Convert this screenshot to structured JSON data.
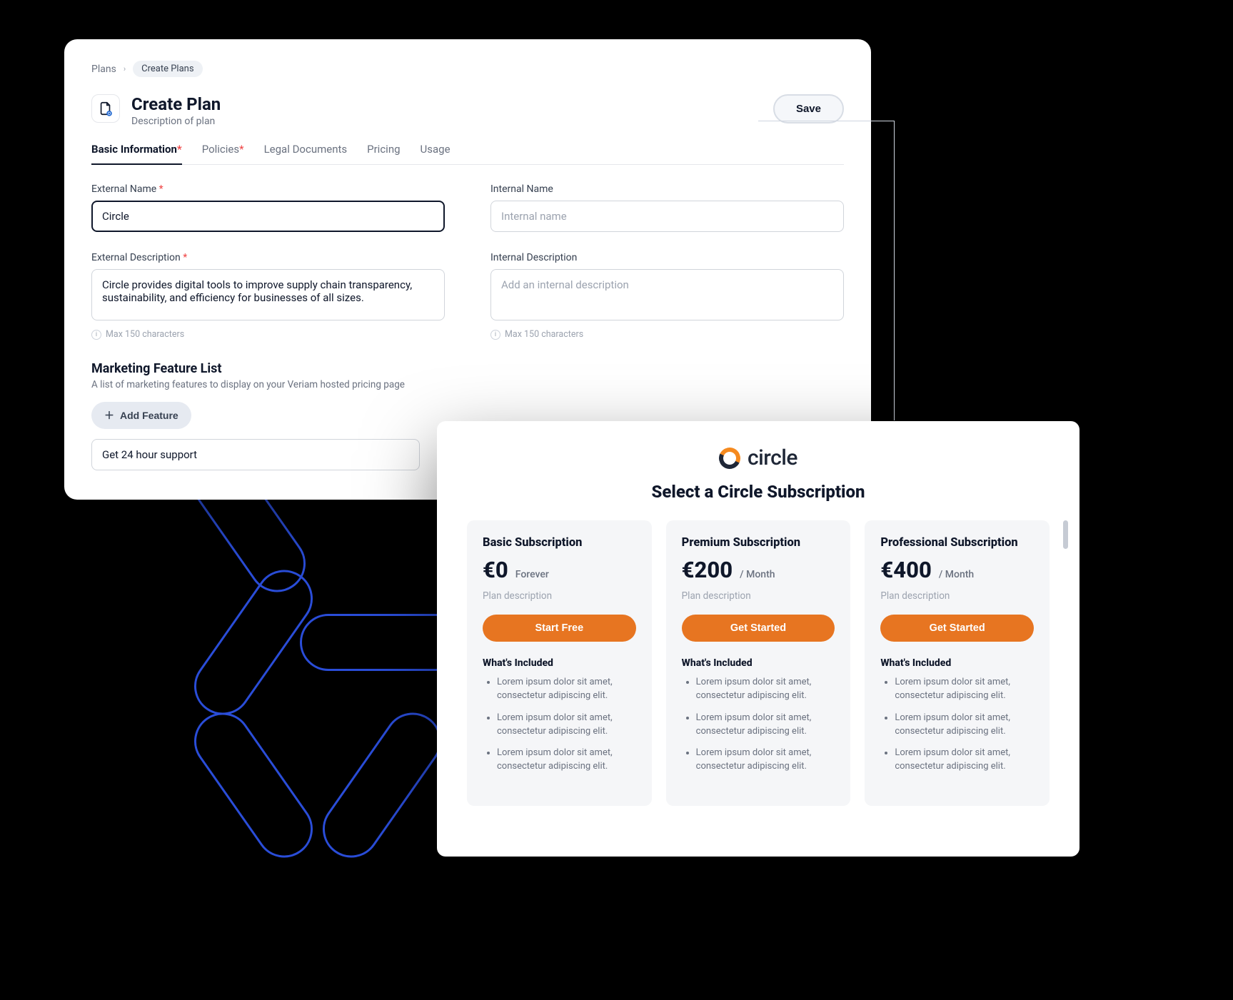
{
  "breadcrumb": {
    "root": "Plans",
    "current": "Create Plans"
  },
  "page": {
    "title": "Create Plan",
    "subtitle": "Description of plan",
    "save": "Save"
  },
  "tabs": [
    {
      "label": "Basic Information",
      "required": true,
      "active": true
    },
    {
      "label": "Policies",
      "required": true,
      "active": false
    },
    {
      "label": "Legal Documents",
      "required": false,
      "active": false
    },
    {
      "label": "Pricing",
      "required": false,
      "active": false
    },
    {
      "label": "Usage",
      "required": false,
      "active": false
    }
  ],
  "form": {
    "external_name": {
      "label": "External Name",
      "value": "Circle"
    },
    "internal_name": {
      "label": "Internal Name",
      "placeholder": "Internal name"
    },
    "external_desc": {
      "label": "External Description",
      "value": "Circle provides digital tools to improve supply chain transparency, sustainability, and efficiency for businesses of all sizes.",
      "hint": "Max 150 characters"
    },
    "internal_desc": {
      "label": "Internal Description",
      "placeholder": "Add an internal description",
      "hint": "Max 150 characters"
    }
  },
  "marketing": {
    "title": "Marketing Feature List",
    "subtitle": "A list of marketing features to display on your Veriam hosted pricing page",
    "add_button": "Add Feature",
    "features": [
      "Get 24 hour support"
    ]
  },
  "pricing": {
    "brand": "circle",
    "title": "Select a Circle Subscription",
    "included_heading": "What's Included",
    "plans": [
      {
        "name": "Basic Subscription",
        "price": "€0",
        "period": "Forever",
        "desc": "Plan description",
        "cta": "Start Free",
        "features": [
          "Lorem ipsum dolor sit amet, consectetur adipiscing elit.",
          "Lorem ipsum dolor sit amet, consectetur adipiscing elit.",
          "Lorem ipsum dolor sit amet, consectetur adipiscing elit."
        ]
      },
      {
        "name": "Premium Subscription",
        "price": "€200",
        "period": "/ Month",
        "desc": "Plan description",
        "cta": "Get Started",
        "features": [
          "Lorem ipsum dolor sit amet, consectetur adipiscing elit.",
          "Lorem ipsum dolor sit amet, consectetur adipiscing elit.",
          "Lorem ipsum dolor sit amet, consectetur adipiscing elit."
        ]
      },
      {
        "name": "Professional Subscription",
        "price": "€400",
        "period": "/ Month",
        "desc": "Plan description",
        "cta": "Get Started",
        "features": [
          "Lorem ipsum dolor sit amet, consectetur adipiscing elit.",
          "Lorem ipsum dolor sit amet, consectetur adipiscing elit.",
          "Lorem ipsum dolor sit amet, consectetur adipiscing elit."
        ]
      }
    ]
  }
}
